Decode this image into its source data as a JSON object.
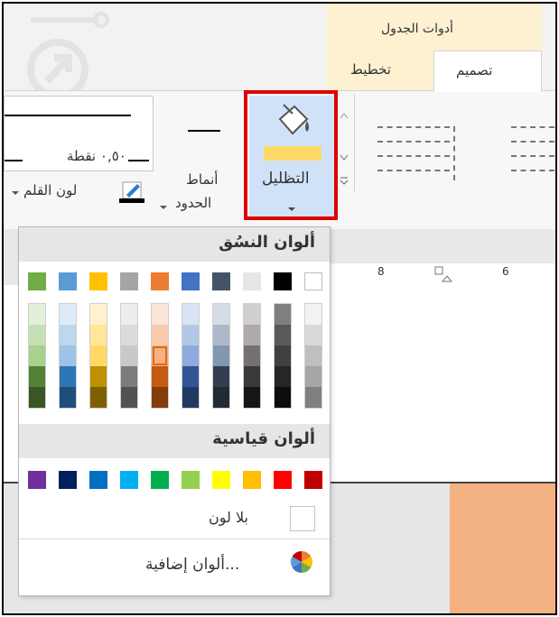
{
  "ribbon": {
    "context_title": "أدوات الجدول",
    "tabs": [
      {
        "label": "تخطيط"
      },
      {
        "label": "تصميم"
      }
    ],
    "pen_weight_label": "٠,٥٠ نقطة",
    "pen_color_label": "لون القلم",
    "border_styles_label_1": "أنماط",
    "border_styles_label_2": "الحدود",
    "shading_label": "التظليل"
  },
  "ruler": {
    "marks": [
      "8",
      "6"
    ]
  },
  "color_menu": {
    "theme_colors_title": "ألوان النسُق",
    "standard_colors_title": "ألوان قياسية",
    "no_color_label": "بلا لون",
    "more_colors_label": "ألوان إضافية...",
    "theme_colors": [
      "#ffffff",
      "#000000",
      "#e7e6e6",
      "#44546a",
      "#4472c4",
      "#ed7d31",
      "#a5a5a5",
      "#ffc000",
      "#5b9bd5",
      "#70ad47"
    ],
    "theme_shades": [
      [
        "#f2f2f2",
        "#d9d9d9",
        "#bfbfbf",
        "#a6a6a6",
        "#808080"
      ],
      [
        "#7f7f7f",
        "#595959",
        "#404040",
        "#262626",
        "#0d0d0d"
      ],
      [
        "#d0cece",
        "#aeaaaa",
        "#757171",
        "#3b3838",
        "#171616"
      ],
      [
        "#d6dce4",
        "#adb9ca",
        "#8497b0",
        "#333f4f",
        "#222a35"
      ],
      [
        "#dae3f3",
        "#b4c7e7",
        "#8faadc",
        "#2f5597",
        "#203864"
      ],
      [
        "#fbe5d6",
        "#f8cbad",
        "#f4b183",
        "#c55a11",
        "#843c0c"
      ],
      [
        "#ededed",
        "#dbdbdb",
        "#c9c9c9",
        "#7b7b7b",
        "#525252"
      ],
      [
        "#fff2cc",
        "#ffe699",
        "#ffd966",
        "#bf9000",
        "#7f6000"
      ],
      [
        "#deebf7",
        "#bdd7ee",
        "#9dc3e6",
        "#2e75b6",
        "#1f4e79"
      ],
      [
        "#e2f0d9",
        "#c5e0b4",
        "#a9d18e",
        "#548235",
        "#385723"
      ]
    ],
    "standard_colors": [
      "#c00000",
      "#ff0000",
      "#ffc000",
      "#ffff00",
      "#92d050",
      "#00b050",
      "#00b0f0",
      "#0070c0",
      "#002060",
      "#7030a0"
    ],
    "selected_shade": "#f4b183"
  }
}
